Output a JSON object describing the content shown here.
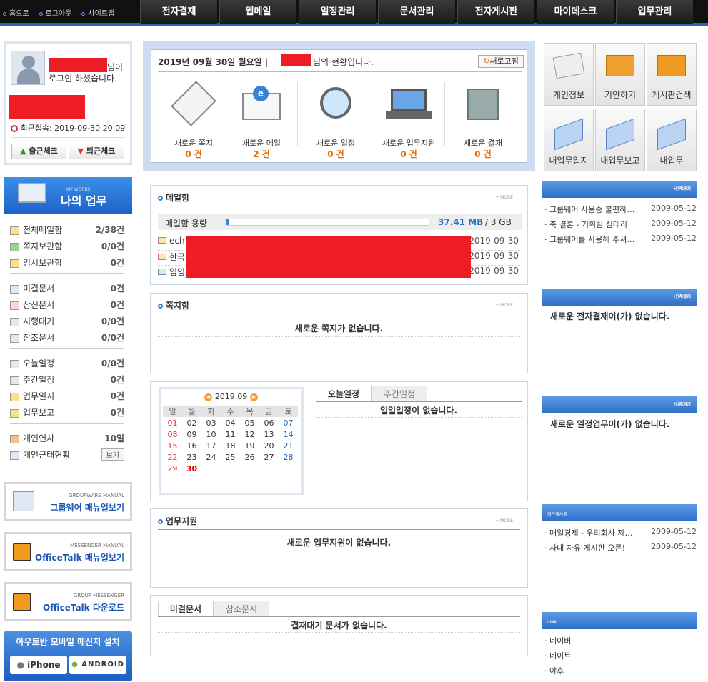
{
  "top_links": [
    "홈으로",
    "로그아웃",
    "사이트맵"
  ],
  "nav": [
    "전자결재",
    "웹메일",
    "일정관리",
    "문서관리",
    "전자게시판",
    "마이데스크",
    "업무관리"
  ],
  "profile": {
    "suffix1": "님이",
    "line2": "로그인 하셨습니다.",
    "last_login": "최근접속: 2019-09-30 20:09",
    "checkin": "출근체크",
    "checkout": "퇴근체크"
  },
  "myworks": {
    "small": "MY WORKS",
    "title": "나의 업무"
  },
  "menu": [
    {
      "label": "전체메일함",
      "value": "2/38건"
    },
    {
      "label": "쪽지보관함",
      "value": "0/0건"
    },
    {
      "label": "임시보관함",
      "value": "0건"
    },
    {
      "label": "미결문서",
      "value": "0건"
    },
    {
      "label": "상신문서",
      "value": "0건"
    },
    {
      "label": "시행대기",
      "value": "0/0건"
    },
    {
      "label": "참조문서",
      "value": "0/0건"
    },
    {
      "label": "오늘일정",
      "value": "0/0건"
    },
    {
      "label": "주간일정",
      "value": "0건"
    },
    {
      "label": "업무일지",
      "value": "0건"
    },
    {
      "label": "업무보고",
      "value": "0건"
    },
    {
      "label": "개인연차",
      "value": "10일"
    },
    {
      "label": "개인근태현황",
      "value": "보기"
    }
  ],
  "banners": [
    {
      "small": "GROUPWARE MANUAL",
      "big": "그룹웨어 매뉴얼보기"
    },
    {
      "small": "MESSENGER MANUAL",
      "big": "OfficeTalk 매뉴얼보기"
    },
    {
      "small": "GROUP MESSENGER",
      "big": "OfficeTalk 다운로드"
    }
  ],
  "mobile": {
    "title": "아우토반 모바일 메신저 설치",
    "iphone": "iPhone",
    "android": "ANDROID"
  },
  "status": {
    "date": "2019년 09월 30일 월요일 |",
    "suffix": "님의 현황입니다.",
    "refresh": "새로고침",
    "items": [
      {
        "label": "새로운 쪽지",
        "count": "0 건"
      },
      {
        "label": "새로운 메일",
        "count": "2 건"
      },
      {
        "label": "새로운 일정",
        "count": "0 건"
      },
      {
        "label": "새로운 업무지원",
        "count": "0 건"
      },
      {
        "label": "새로운 결재",
        "count": "0 건"
      }
    ]
  },
  "quick": [
    "개인정보",
    "기안하기",
    "게시판검색",
    "내업무일지",
    "내업무보고",
    "내업무"
  ],
  "mailbox": {
    "title": "메일함",
    "more": "+ MORE",
    "usage_label": "메일함 용량",
    "usage_value": "37.41 MB",
    "usage_total": "/ 3 GB",
    "usage_fraction": 0.012,
    "rows": [
      {
        "prefix": "ech",
        "date": "2019-09-30"
      },
      {
        "prefix": "한국",
        "date": "2019-09-30"
      },
      {
        "prefix": "임영",
        "date": "2019-09-30"
      }
    ]
  },
  "memo": {
    "title": "쪽지함",
    "more": "+ MORE",
    "empty": "새로운 쪽지가 없습니다."
  },
  "calendar": {
    "month": "2019.09",
    "weekdays": [
      "일",
      "월",
      "화",
      "수",
      "목",
      "금",
      "토"
    ],
    "weeks": [
      [
        "01",
        "02",
        "03",
        "04",
        "05",
        "06",
        "07"
      ],
      [
        "08",
        "09",
        "10",
        "11",
        "12",
        "13",
        "14"
      ],
      [
        "15",
        "16",
        "17",
        "18",
        "19",
        "20",
        "21"
      ],
      [
        "22",
        "23",
        "24",
        "25",
        "26",
        "27",
        "28"
      ],
      [
        "29",
        "30",
        "",
        "",
        "",
        "",
        ""
      ]
    ],
    "today": "30"
  },
  "schedule": {
    "tab1": "오늘일정",
    "tab2": "주간일정",
    "empty": "일일일정이 없습니다."
  },
  "support": {
    "title": "업무지원",
    "more": "+ MORE",
    "empty": "새로운 업무지원이 없습니다."
  },
  "docs": {
    "tab1": "미결문서",
    "tab2": "참조문서",
    "empty": "결재대기 문서가 없습니다."
  },
  "notice": {
    "title": "전체공지",
    "more": "+ MORE",
    "rows": [
      {
        "text": "그룹웨어 사용중 불편하…",
        "date": "2009-05-12"
      },
      {
        "text": "축 결혼 - 기획팀 심대리",
        "date": "2009-05-12"
      },
      {
        "text": "그룹웨어를 사용해 주셔…",
        "date": "2009-05-12"
      }
    ]
  },
  "approval": {
    "title": "전자결재",
    "more": "+ MORE",
    "empty": "새로운 전자결재이(가) 없습니다."
  },
  "tasks": {
    "title": "일정업무",
    "more": "+ MORE",
    "empty": "새로운 일정업무이(가) 없습니다."
  },
  "recent": {
    "title": "최근게시물",
    "rows": [
      {
        "text": "매일경제 - 우리회사 제…",
        "date": "2009-05-12"
      },
      {
        "text": "사내 자유 게시판 오픈!",
        "date": "2009-05-12"
      }
    ]
  },
  "link": {
    "title": "LINK",
    "rows": [
      "네이버",
      "네이트",
      "야후"
    ]
  }
}
